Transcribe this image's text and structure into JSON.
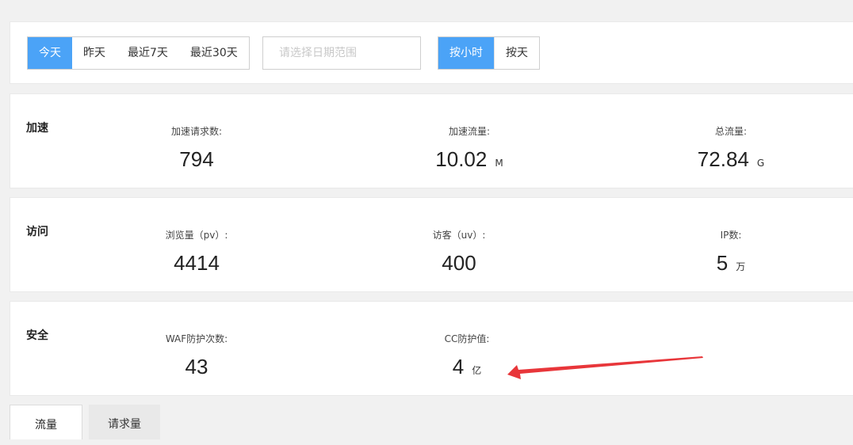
{
  "filters": {
    "range_buttons": [
      "今天",
      "昨天",
      "最近7天",
      "最近30天"
    ],
    "date_placeholder": "请选择日期范围",
    "granularity_buttons": [
      "按小时",
      "按天"
    ]
  },
  "acceleration": {
    "title": "加速",
    "metrics": [
      {
        "label": "加速请求数:",
        "value": "794",
        "unit": ""
      },
      {
        "label": "加速流量:",
        "value": "10.02",
        "unit": "M"
      },
      {
        "label": "总流量:",
        "value": "72.84",
        "unit": "G"
      }
    ]
  },
  "visits": {
    "title": "访问",
    "metrics": [
      {
        "label": "浏览量（pv）:",
        "value": "4414",
        "unit": ""
      },
      {
        "label": "访客（uv）:",
        "value": "400",
        "unit": ""
      },
      {
        "label": "IP数:",
        "value": "5",
        "unit": "万"
      }
    ]
  },
  "security": {
    "title": "安全",
    "metrics": [
      {
        "label": "WAF防护次数:",
        "value": "43",
        "unit": ""
      },
      {
        "label": "CC防护值:",
        "value": "4",
        "unit": "亿"
      }
    ]
  },
  "tabs": [
    "流量",
    "请求量"
  ],
  "colors": {
    "accent": "#4ba3f7",
    "annotation_arrow": "#e8363a"
  }
}
